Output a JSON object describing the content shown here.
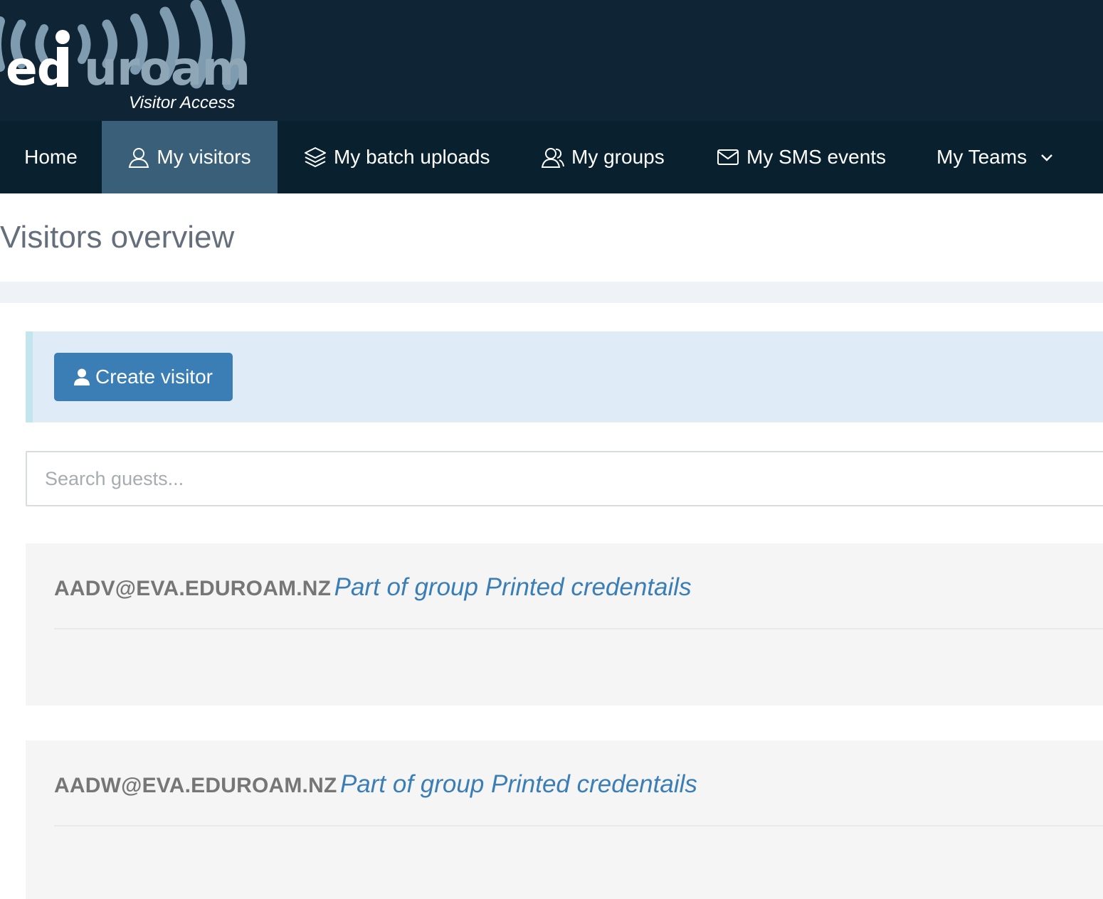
{
  "brand": {
    "logo_text_white_1": "ed",
    "logo_text_blue": "u",
    "logo_text_blue_2": "roam",
    "subtitle": "Visitor Access",
    "colors": {
      "header_bg": "#0f2536",
      "nav_bg": "#09202f",
      "nav_active_bg": "#3a6079",
      "logo_wave": "#7f9bb0"
    }
  },
  "nav": {
    "items": [
      {
        "label": "Home",
        "icon": "",
        "active": false
      },
      {
        "label": "My visitors",
        "icon": "user-icon",
        "active": true
      },
      {
        "label": "My batch uploads",
        "icon": "layers-icon",
        "active": false
      },
      {
        "label": "My groups",
        "icon": "users-icon",
        "active": false
      },
      {
        "label": "My SMS events",
        "icon": "envelope-icon",
        "active": false
      },
      {
        "label": "My Teams",
        "icon": "chevron-down-icon",
        "active": false
      }
    ]
  },
  "page": {
    "title": "Visitors overview"
  },
  "actions": {
    "create_label": "Create visitor",
    "create_icon": "user-solid-icon",
    "button_color": "#3a7eb5"
  },
  "search": {
    "placeholder": "Search guests...",
    "value": ""
  },
  "visitors": [
    {
      "id": "AADV@EVA.EDUROAM.NZ",
      "group_text": "Part of group Printed credentails"
    },
    {
      "id": "AADW@EVA.EDUROAM.NZ",
      "group_text": "Part of group Printed credentails"
    }
  ]
}
